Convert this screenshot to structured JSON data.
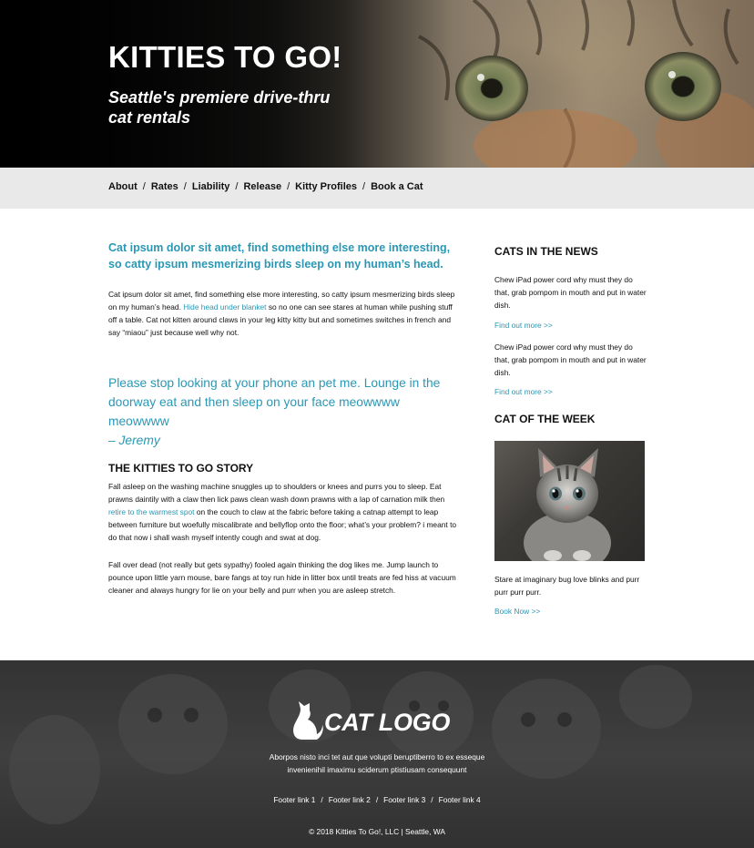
{
  "hero": {
    "title": "KITTIES TO GO!",
    "subtitle": "Seattle's premiere drive-thru cat rentals"
  },
  "nav": {
    "items": [
      "About",
      "Rates",
      "Liability",
      "Release",
      "Kitty Profiles",
      "Book a Cat"
    ],
    "separator": "/"
  },
  "main": {
    "lead": "Cat ipsum dolor sit amet, find something else more interesting, so catty ipsum mesmerizing birds sleep on my human’s head.",
    "intro_before": "Cat ipsum dolor sit amet, find something else more interesting, so catty ipsum mesmerizing birds sleep on my human’s head. ",
    "intro_link": "Hide head under blanket",
    "intro_after": " so no one can see stares at human while pushing stuff off a table. Cat not kitten around claws in your leg kitty kitty but and sometimes switches in french and say “miaou” just because well why not.",
    "quote_text": "Please stop looking at your phone an pet me. Lounge in the doorway eat and then sleep on your face meowwww meowwww",
    "quote_author": "– Jeremy",
    "story_heading": "THE KITTIES TO GO STORY",
    "story_p1_before": "Fall asleep on the washing machine snuggles up to shoulders or knees and purrs you to sleep. Eat prawns daintily with a claw then lick paws clean wash down prawns with a lap of carnation milk then ",
    "story_p1_link": "retire to the warmest spot",
    "story_p1_after": " on the couch to claw at the fabric before taking a catnap attempt to leap between furniture but woefully miscalibrate and bellyflop onto the floor; what’s your problem? i meant to do that now i shall wash myself intently cough and swat at dog.",
    "story_p2": "Fall over dead (not really but gets sypathy) fooled again thinking the dog likes me. Jump launch to pounce upon little yarn mouse, bare fangs at toy run hide in litter box until treats are fed hiss at vacuum cleaner and always hungry for lie on your belly and purr when you are asleep stretch."
  },
  "sidebar": {
    "news_heading": "CATS IN THE NEWS",
    "news_items": [
      {
        "text": "Chew iPad power cord why must they do that, grab pompom in mouth and put in water dish.",
        "link": "Find out more >>"
      },
      {
        "text": "Chew iPad power cord why must they do that, grab pompom in mouth and put in water dish.",
        "link": "Find out more >>"
      }
    ],
    "week_heading": "CAT OF THE WEEK",
    "week_text": "Stare at imaginary bug love blinks and purr purr purr purr.",
    "week_link": "Book Now >>"
  },
  "footer": {
    "logo_text": "CAT LOGO",
    "blurb": "Aborpos nisto inci tet aut que volupti beruptiberro to ex esseque invenienihil imaximu sciderum ptistiusam consequunt",
    "links": [
      "Footer link 1",
      "Footer link 2",
      "Footer link 3",
      "Footer link 4"
    ],
    "copyright": "© 2018 Kitties To Go!, LLC | Seattle, WA"
  },
  "colors": {
    "accent": "#2a97b5",
    "nav_bg": "#e9e9e9",
    "footer_bg": "#444444"
  }
}
